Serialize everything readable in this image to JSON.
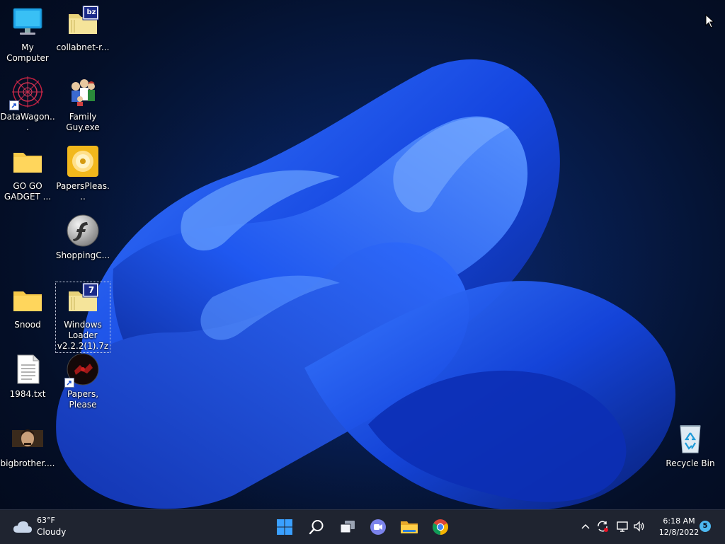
{
  "desktop": {
    "icons": [
      {
        "label": "My Computer",
        "icon": "computer-icon"
      },
      {
        "label": "collabnet-r...",
        "icon": "archive-folder-icon",
        "badge": "bz"
      },
      {
        "label": "DataWagon...",
        "icon": "spider-web-icon"
      },
      {
        "label": "Family Guy.exe",
        "icon": "family-guy-icon"
      },
      {
        "label": "GO GO GADGET ...",
        "icon": "folder-icon"
      },
      {
        "label": "PapersPleas...",
        "icon": "disc-image-icon"
      },
      {
        "label": "ShoppingC...",
        "icon": "flash-icon"
      },
      {
        "label": "Snood",
        "icon": "folder-icon"
      },
      {
        "label": "Windows Loader v2.2.2(1).7z",
        "icon": "archive-folder-icon",
        "badge": "7"
      },
      {
        "label": "1984.txt",
        "icon": "text-file-icon"
      },
      {
        "label": "Papers, Please",
        "icon": "papers-please-icon"
      },
      {
        "label": "bigbrother....",
        "icon": "image-file-icon"
      },
      {
        "label": "Recycle Bin",
        "icon": "recycle-bin-icon"
      }
    ]
  },
  "taskbar": {
    "weather": {
      "temp": "63°F",
      "condition": "Cloudy"
    },
    "apps": [
      {
        "name": "start-button",
        "icon": "windows-logo-icon"
      },
      {
        "name": "search-button",
        "icon": "search-icon"
      },
      {
        "name": "task-view-button",
        "icon": "task-view-icon"
      },
      {
        "name": "teams-chat-button",
        "icon": "teams-chat-icon"
      },
      {
        "name": "file-explorer-button",
        "icon": "folder-icon"
      },
      {
        "name": "chrome-button",
        "icon": "chrome-icon"
      }
    ],
    "tray": {
      "time": "6:18 AM",
      "date": "12/8/2022",
      "notifications": "5"
    }
  },
  "colors": {
    "taskbar": "#1f2430",
    "accent": "#1a6cff",
    "wallpaper_bg": "#061a45"
  }
}
